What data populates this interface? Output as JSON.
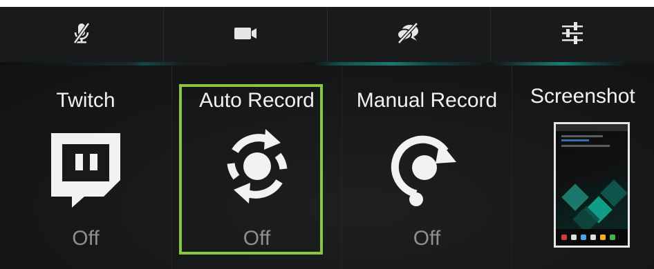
{
  "toolbar": {
    "items": [
      {
        "icon": "mic-muted-icon"
      },
      {
        "icon": "video-camera-icon"
      },
      {
        "icon": "chat-muted-icon"
      },
      {
        "icon": "sliders-icon"
      }
    ]
  },
  "tiles": [
    {
      "label": "Twitch",
      "status": "Off",
      "icon": "twitch-icon"
    },
    {
      "label": "Auto Record",
      "status": "Off",
      "icon": "auto-record-icon",
      "selected": true
    },
    {
      "label": "Manual Record",
      "status": "Off",
      "icon": "manual-record-icon"
    },
    {
      "label": "Screenshot",
      "icon": "screenshot-thumbnail"
    }
  ],
  "colors": {
    "selection": "#8cc63f",
    "accent": "#1c7a70",
    "label": "#f2f2f2",
    "status": "#8d8f90"
  }
}
